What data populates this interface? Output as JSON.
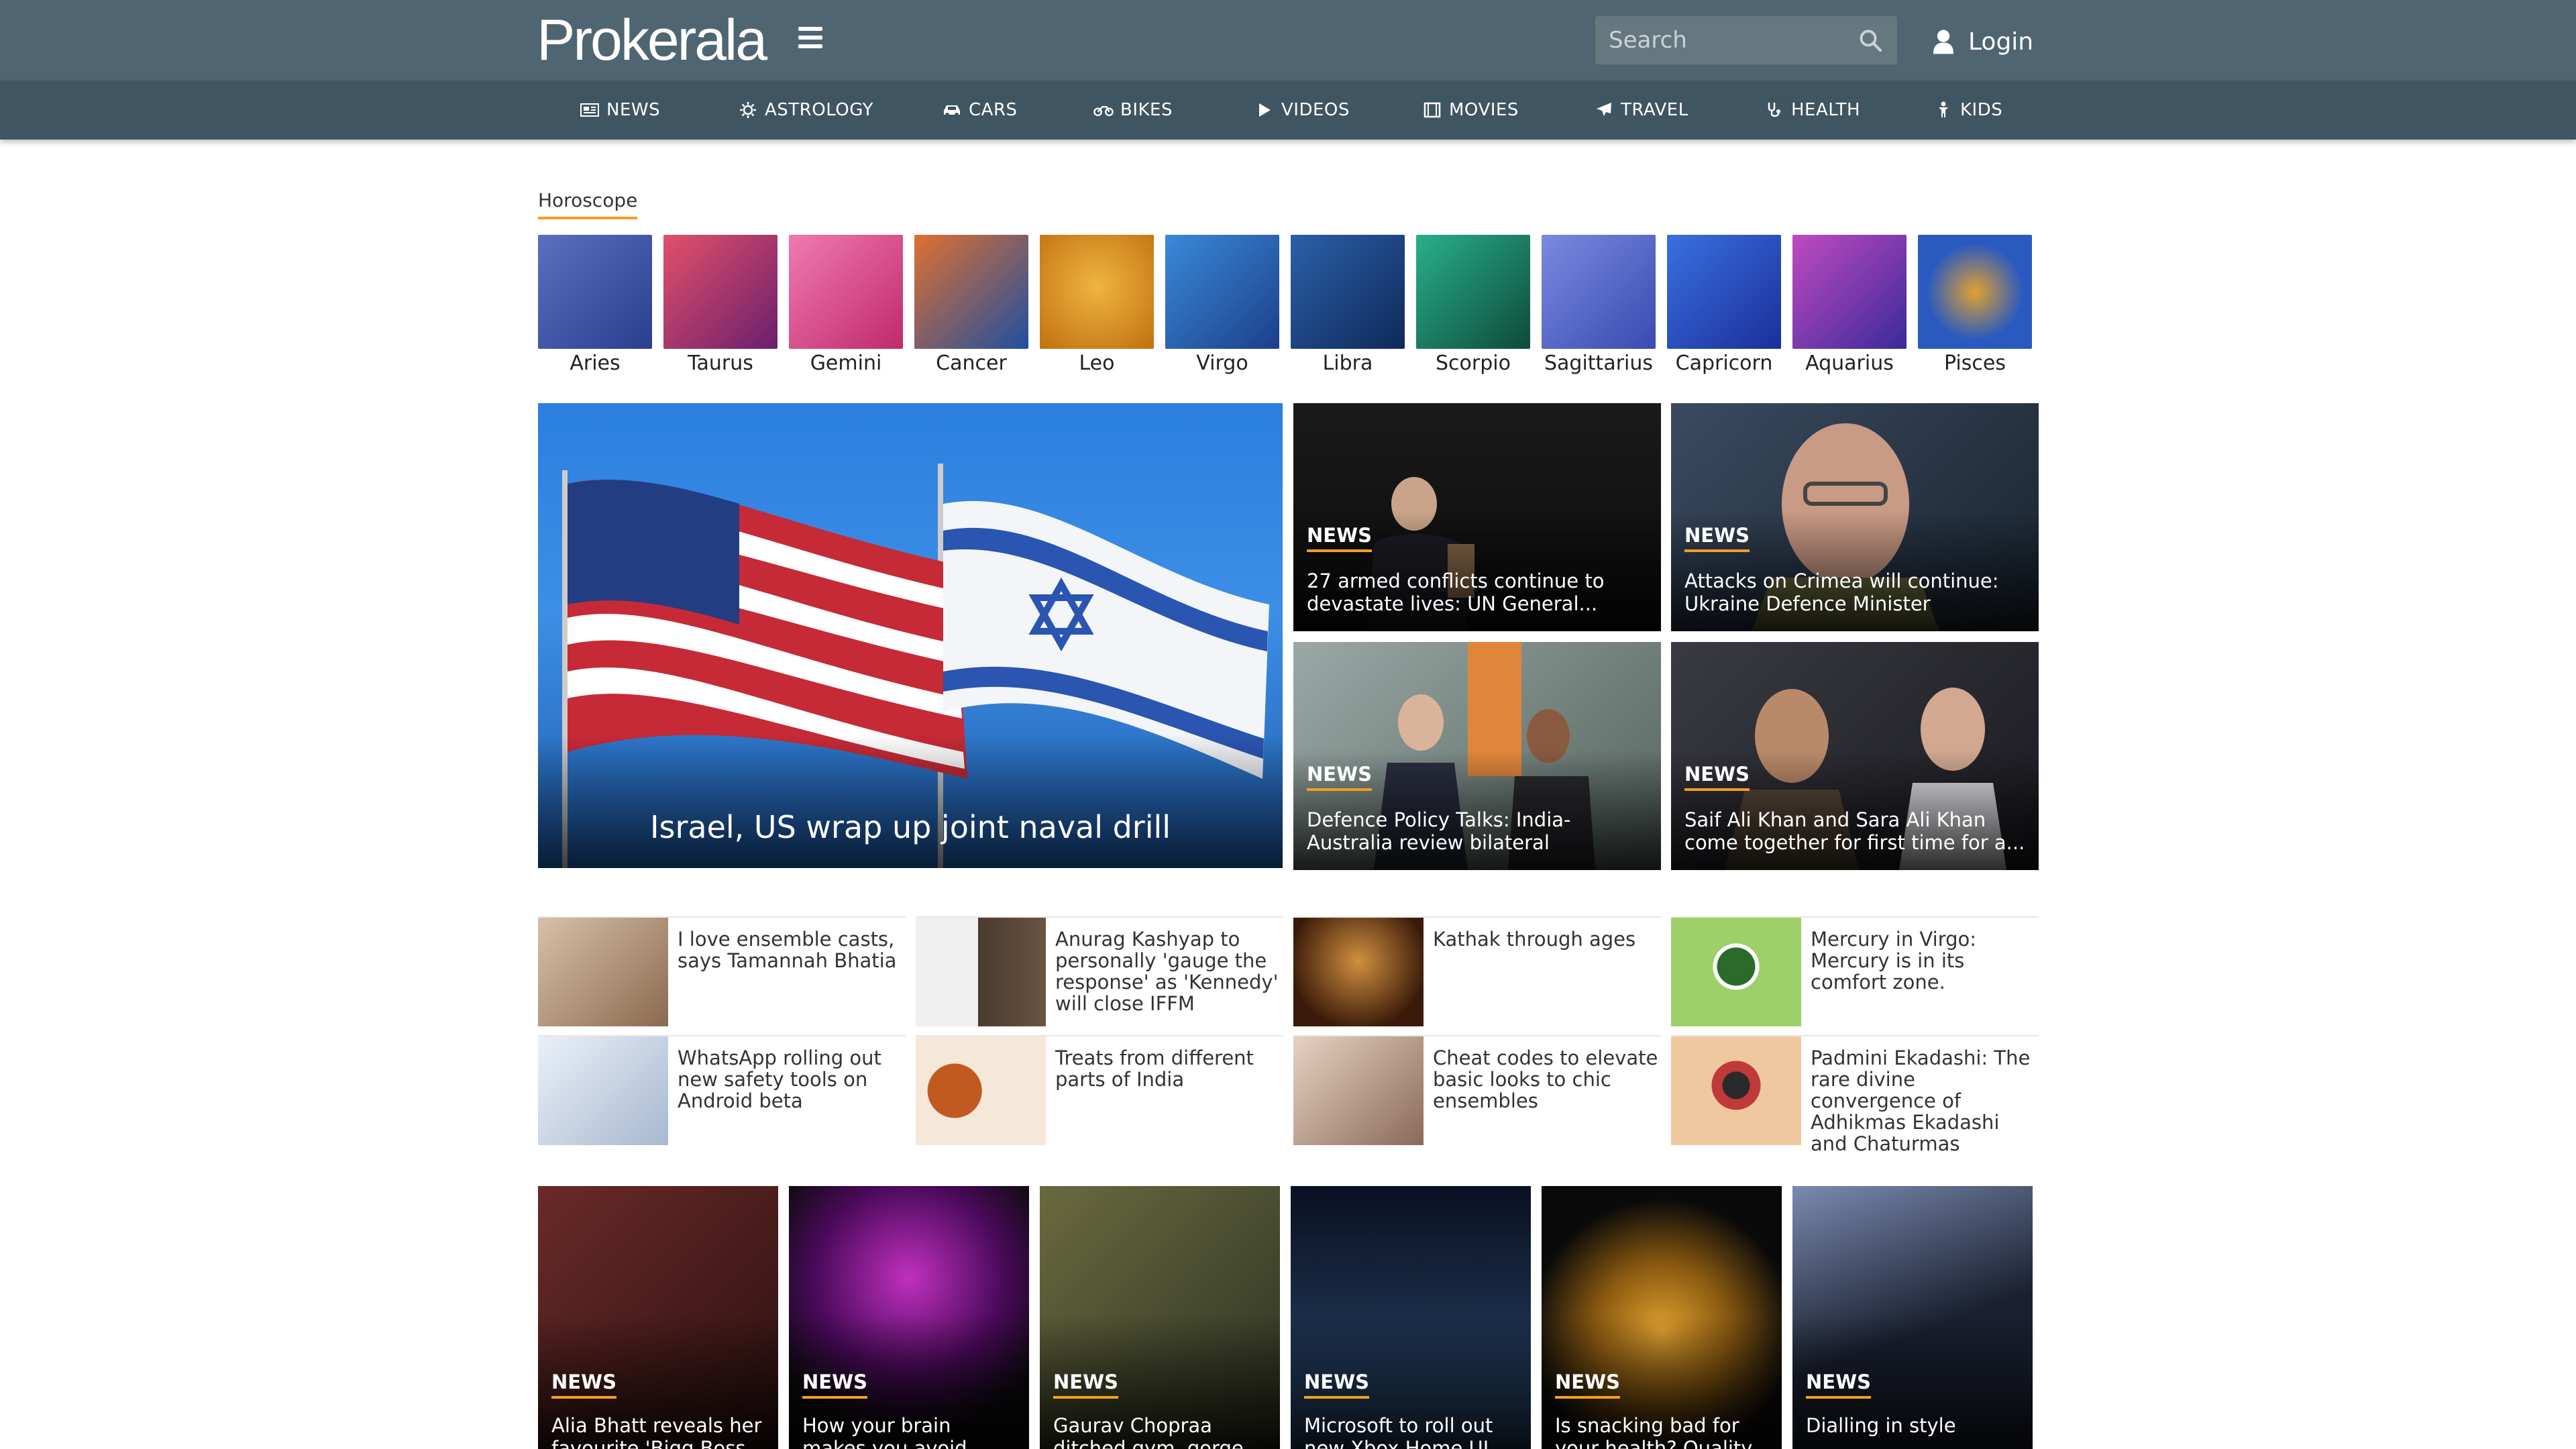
{
  "header": {
    "logo_text": "Prokerala",
    "search_placeholder": "Search",
    "login_label": "Login"
  },
  "nav": [
    {
      "label": "NEWS",
      "icon": "newspaper-icon"
    },
    {
      "label": "ASTROLOGY",
      "icon": "sun-icon"
    },
    {
      "label": "CARS",
      "icon": "car-icon"
    },
    {
      "label": "BIKES",
      "icon": "motorbike-icon"
    },
    {
      "label": "VIDEOS",
      "icon": "play-icon"
    },
    {
      "label": "MOVIES",
      "icon": "film-icon"
    },
    {
      "label": "TRAVEL",
      "icon": "plane-icon"
    },
    {
      "label": "HEALTH",
      "icon": "stethoscope-icon"
    },
    {
      "label": "KIDS",
      "icon": "child-icon"
    }
  ],
  "horoscope": {
    "title": "Horoscope",
    "signs": [
      "Aries",
      "Taurus",
      "Gemini",
      "Cancer",
      "Leo",
      "Virgo",
      "Libra",
      "Scorpio",
      "Sagittarius",
      "Capricorn",
      "Aquarius",
      "Pisces"
    ],
    "colors": [
      "#3a4f9e",
      "#c43a5e",
      "#e84e8a",
      "#2a64b0",
      "#e09a20",
      "#2a6cc0",
      "#1e3f80",
      "#1f8a6a",
      "#5a6ad0",
      "#2a5fd0",
      "#5a3ab0",
      "#3b7ad8"
    ]
  },
  "featured": {
    "main_title": "Israel, US wrap up joint naval drill",
    "badge": "NEWS",
    "tiles": [
      {
        "title": "27 armed conflicts continue to devastate lives: UN General..."
      },
      {
        "title": "Attacks on Crimea will continue: Ukraine Defence Minister"
      },
      {
        "title": "Defence Policy Talks: India-Australia review bilateral cooperation in..."
      },
      {
        "title": "Saif Ali Khan and Sara Ali Khan come together for first time for a..."
      }
    ]
  },
  "small_items": [
    {
      "title": "I love ensemble casts, says Tamannah Bhatia"
    },
    {
      "title": "Anurag Kashyap to personally 'gauge the response' as 'Kennedy' will close IFFM"
    },
    {
      "title": "Kathak through ages"
    },
    {
      "title": "Mercury in Virgo: Mercury is in its comfort zone."
    },
    {
      "title": "WhatsApp rolling out new safety tools on Android beta"
    },
    {
      "title": "Treats from different parts of India"
    },
    {
      "title": "Cheat codes to elevate basic looks to chic ensembles"
    },
    {
      "title": "Padmini Ekadashi: The rare divine convergence of Adhikmas Ekadashi and Chaturmas"
    }
  ],
  "bottom_cards": [
    {
      "title": "Alia Bhatt reveals her favourite 'Bigg Boss..."
    },
    {
      "title": "How your brain makes you avoid foods that..."
    },
    {
      "title": "Gaurav Chopraa ditched gym, gorge..."
    },
    {
      "title": "Microsoft to roll out new Xbox Home UI..."
    },
    {
      "title": "Is snacking bad for your health? Quality..."
    },
    {
      "title": "Dialling in style"
    }
  ],
  "colors": {
    "header_bg": "#4f6572",
    "nav_bg": "#3f5562",
    "accent": "#f0a020",
    "logo_dot": "#f2b400"
  }
}
